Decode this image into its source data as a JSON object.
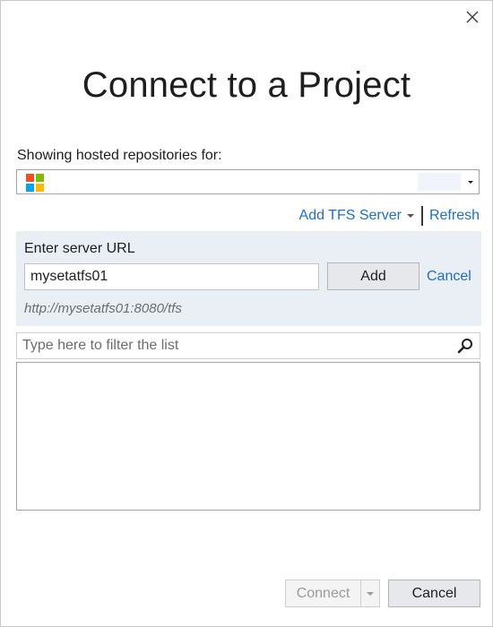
{
  "dialog": {
    "title": "Connect to a Project",
    "close_icon": "close-icon"
  },
  "hosted": {
    "label": "Showing hosted repositories for:",
    "account_icon": "microsoft-logo-icon",
    "logo_colors": [
      "#f25022",
      "#7fba00",
      "#00a4ef",
      "#ffb900"
    ]
  },
  "links": {
    "add_tfs_server": "Add TFS Server",
    "refresh": "Refresh",
    "color": "#1e6fc5"
  },
  "server_panel": {
    "label": "Enter server URL",
    "url_value": "mysetatfs01",
    "add_label": "Add",
    "cancel_label": "Cancel",
    "hint": "http://mysetatfs01:8080/tfs"
  },
  "filter": {
    "placeholder": "Type here to filter the list",
    "icon": "search-icon"
  },
  "footer": {
    "connect_label": "Connect",
    "cancel_label": "Cancel"
  }
}
